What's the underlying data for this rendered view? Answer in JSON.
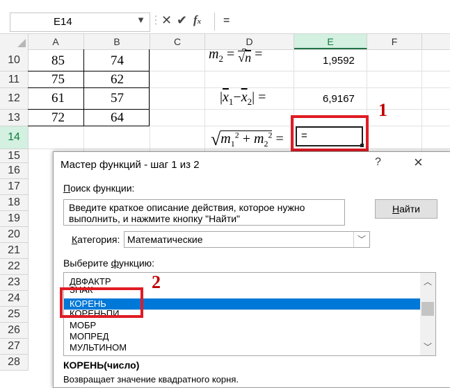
{
  "formula_bar": {
    "name_box": "E14",
    "formula": "="
  },
  "columns": [
    "A",
    "B",
    "C",
    "D",
    "E",
    "F"
  ],
  "rows": [
    "10",
    "11",
    "12",
    "13",
    "14",
    "15",
    "16",
    "17",
    "18",
    "19",
    "20",
    "21",
    "22",
    "23",
    "24",
    "25",
    "26",
    "27",
    "28"
  ],
  "cells": [
    {
      "a": "85",
      "b": "74"
    },
    {
      "a": "75",
      "b": "62"
    },
    {
      "a": "61",
      "b": "57"
    },
    {
      "a": "72",
      "b": "64"
    }
  ],
  "e_values": {
    "r10": "1,9592",
    "r12": "6,9167",
    "r14": "="
  },
  "annotations": {
    "one": "1",
    "two": "2"
  },
  "dialog": {
    "title": "Мастер функций - шаг 1 из 2",
    "help": "?",
    "close": "×",
    "search_label": "Поиск функции:",
    "search_text_1": "Введите краткое описание действия, которое нужно",
    "search_text_2": "выполнить, и нажмите кнопку \"Найти\"",
    "find_button": "Найти",
    "category_label": "Категория:",
    "category_value": "Математические",
    "choose_label": "Выберите функцию:",
    "functions": [
      "ДВФАКТР",
      "ЗНАК",
      "КОРЕНЬ",
      "КОРЕНЬПИ",
      "МОБР",
      "МОПРЕД",
      "МУЛЬТИНОМ"
    ],
    "selected_function": "КОРЕНЬ",
    "signature": "КОРЕНЬ(число)",
    "description": "Возвращает значение квадратного корня."
  },
  "colors": {
    "accent": "#0078d7",
    "annotation_red": "#e01b24",
    "excel_green": "#217346"
  }
}
